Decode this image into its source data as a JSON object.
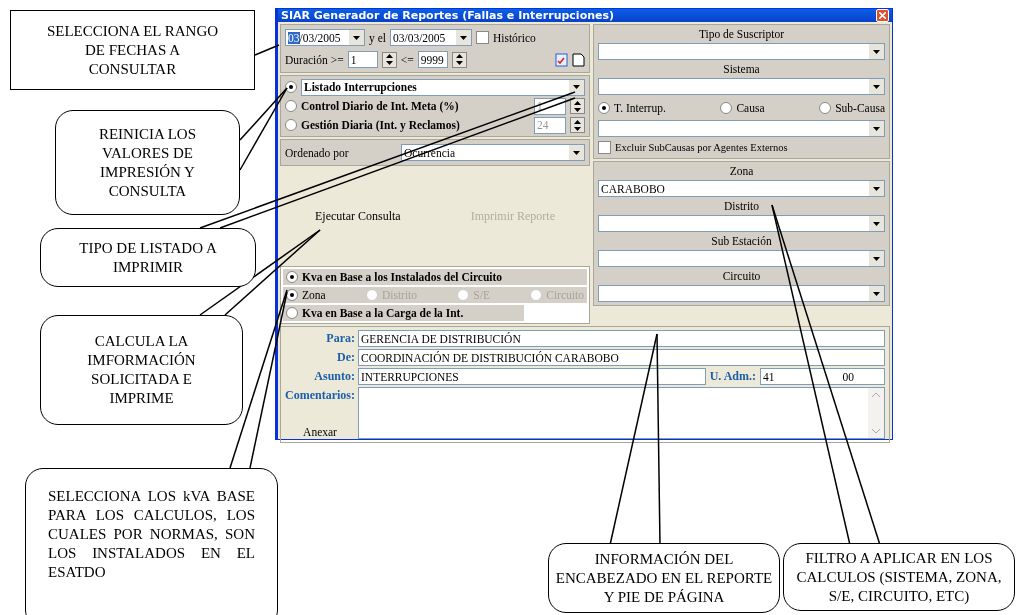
{
  "window": {
    "title": "SIAR Generador de Reportes (Fallas e Interrupciones)"
  },
  "dates": {
    "from_highlight": "03",
    "from_rest": "/03/2005",
    "connector": "y el",
    "to": "03/03/2005",
    "historico": {
      "label": "Histórico",
      "checked": false
    }
  },
  "duration": {
    "label": "Duración >=",
    "min": "1",
    "max_label": "<=",
    "max": "9999"
  },
  "report_types": [
    {
      "kind": "combo",
      "label": "Listado Interrupciones",
      "selected": true
    },
    {
      "kind": "spin",
      "label": "Control Diario de Int.  Meta (%)",
      "value": "1",
      "selected": false
    },
    {
      "kind": "spin",
      "label": "Gestión Diaria (Int. y Reclamos)",
      "value": "24",
      "selected": false
    }
  ],
  "order": {
    "label": "Ordenado por",
    "value": "Ocurrencia"
  },
  "actions": [
    {
      "label": "Ejecutar Consulta",
      "disabled": false
    },
    {
      "label": "Imprimir Reporte",
      "disabled": true
    }
  ],
  "kva": {
    "options": [
      {
        "label": "Kva en Base a los Instalados del Circuito",
        "selected": true
      },
      {
        "label": "Kva en Base a la Carga de la Int.",
        "selected": false
      }
    ],
    "levels": [
      {
        "label": "Zona",
        "selected": true,
        "disabled": false
      },
      {
        "label": "Distrito",
        "selected": false,
        "disabled": true
      },
      {
        "label": "S/E",
        "selected": false,
        "disabled": true
      },
      {
        "label": "Circuito",
        "selected": false,
        "disabled": true
      }
    ]
  },
  "filters_top": [
    {
      "label": "Tipo de Suscriptor"
    },
    {
      "label": "Sistema"
    }
  ],
  "cause_modes": [
    {
      "label": "T. Interrup.",
      "selected": true
    },
    {
      "label": "Causa",
      "selected": false
    },
    {
      "label": "Sub-Causa",
      "selected": false
    }
  ],
  "exclude": {
    "label": "Excluir SubCausas por Agentes Externos",
    "checked": false
  },
  "filters_bottom": [
    {
      "label": "Zona",
      "value": "CARABOBO"
    },
    {
      "label": "Distrito"
    },
    {
      "label": "Sub Estación"
    },
    {
      "label": "Circuito"
    }
  ],
  "header": {
    "para": {
      "label": "Para:",
      "value": "GERENCIA DE DISTRIBUCIÓN"
    },
    "de": {
      "label": "De:",
      "value": "COORDINACIÓN DE DISTRIBUCIÓN CARABOBO"
    },
    "asunto": {
      "label": "Asunto:",
      "value": "INTERRUPCIONES"
    },
    "uadm": {
      "label": "U. Adm.:",
      "value_start": "41",
      "value_end": "00"
    },
    "comentarios": {
      "label": "Comentarios:"
    },
    "anexar": "Anexar"
  },
  "callouts": [
    {
      "kind": "square",
      "text": "SELECCIONA EL RANGO DE FECHAS A CONSULTAR"
    },
    {
      "kind": "round",
      "text": "REINICIA LOS VALORES DE IMPRESIÓN Y CONSULTA"
    },
    {
      "kind": "round",
      "text": "TIPO DE LISTADO A IMPRIMIR"
    },
    {
      "kind": "round",
      "text": "CALCULA LA IMFORMACIÓN SOLICITADA E IMPRIME"
    },
    {
      "kind": "justify",
      "text": "SELECCIONA LOS kVA BASE PARA LOS CALCULOS, LOS CUALES POR NORMAS, SON LOS INSTALADOS EN EL ESATDO"
    },
    {
      "kind": "round",
      "text": "INFORMACIÓN DEL ENCABEZADO EN EL REPORTE Y PIE DE PÁGINA"
    },
    {
      "kind": "round",
      "text": "FILTRO A APLICAR EN LOS CALCULOS (SISTEMA, ZONA, S/E, CIRCUITO, ETC)"
    }
  ]
}
